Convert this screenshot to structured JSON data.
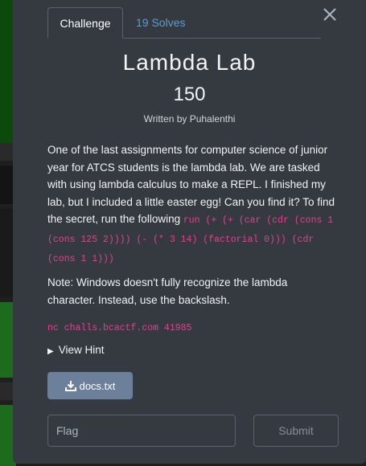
{
  "tabs": {
    "challenge_label": "Challenge",
    "solves_label": "19 Solves"
  },
  "challenge": {
    "name": "Lambda Lab",
    "points": "150",
    "author": "Written by Puhalenthi",
    "description_text": "One of the last assignments for computer science of junior year for ATCS students is the lambda lab. We are tasked with using lambda calculus to make a REPL. I finished my lab, but I included a little easter egg! Can you find it? To find the secret, run the following ",
    "description_code": "run (+ (+ (car (cdr (cons 1 (cons 125 2)))) (- (* 3 14) (factorial 0))) (cdr (cons 1 1)))",
    "note": "Note: Windows doesn't fully recognize the lambda character. Instead, use the backslash.",
    "connection": "nc challs.bcactf.com 41985",
    "hint_label": "View Hint",
    "file_label": "docs.txt"
  },
  "form": {
    "flag_placeholder": "Flag",
    "submit_label": "Submit"
  },
  "icons": {
    "close": "close-icon",
    "hint": "triangle-right-icon",
    "download": "download-icon"
  },
  "colors": {
    "modal_bg": "#343a40",
    "link": "#5b9bd5",
    "code": "#e83e8c",
    "file_button": "#6c7f9b"
  }
}
